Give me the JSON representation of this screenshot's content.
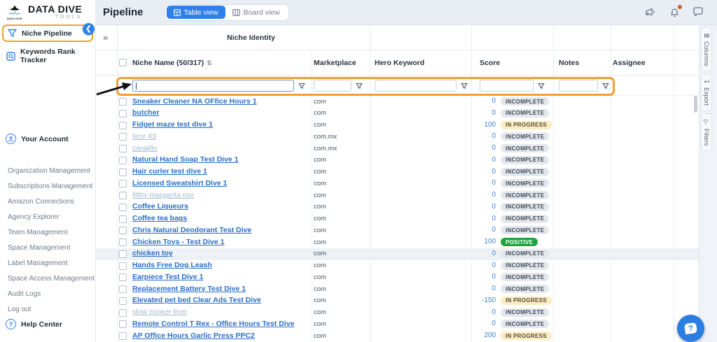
{
  "brand": {
    "name": "DATA DIVE",
    "sub": "TOOLS",
    "logo_caption": "DATA DIVE"
  },
  "topbar": {
    "title": "Pipeline",
    "views": [
      {
        "label": "Table view",
        "active": true
      },
      {
        "label": "Board view",
        "active": false
      }
    ],
    "icons": [
      "megaphone-icon",
      "bell-icon",
      "chat-icon"
    ]
  },
  "sidebar": {
    "nav": [
      {
        "label": "Niche Pipeline",
        "icon": "funnel-icon",
        "highlighted": true
      },
      {
        "label": "Keywords Rank Tracker",
        "icon": "keyword-search-icon"
      }
    ],
    "account_label": "Your Account",
    "management_links": [
      "Organization Management",
      "Subscriptions Management",
      "Amazon Connections",
      "Agency Explorer",
      "Team Management",
      "Space Management",
      "Label Management",
      "Space Access Management",
      "Audit Logs",
      "Log out"
    ],
    "help_label": "Help Center"
  },
  "table": {
    "group_header": "Niche Identity",
    "expand_glyph": "»",
    "columns": {
      "niche_name": "Niche Name (50/317)",
      "marketplace": "Marketplace",
      "hero_keyword": "Hero Keyword",
      "score": "Score",
      "notes": "Notes",
      "assignee": "Assignee"
    },
    "filters": [
      {
        "column": "niche_name",
        "value": "",
        "placeholder": "",
        "focused": true
      },
      {
        "column": "marketplace",
        "value": "",
        "placeholder": "",
        "focused": false
      },
      {
        "column": "hero_keyword",
        "value": "",
        "placeholder": "",
        "focused": false
      },
      {
        "column": "score",
        "value": "",
        "placeholder": "",
        "focused": false
      },
      {
        "column": "notes",
        "value": "",
        "placeholder": "",
        "focused": false
      }
    ],
    "rows": [
      {
        "name": "Sneaker Cleaner NA OFfice Hours 1",
        "marketplace": "com",
        "score": 0,
        "status": "INCOMPLETE",
        "emphasis": "strong",
        "highlighted": false
      },
      {
        "name": "butcher",
        "marketplace": "com",
        "score": 0,
        "status": "INCOMPLETE",
        "emphasis": "strong",
        "highlighted": false
      },
      {
        "name": "Fidget maze test dive 1",
        "marketplace": "com",
        "score": 100,
        "status": "IN PROGRESS",
        "emphasis": "strong",
        "highlighted": false
      },
      {
        "name": "licor 43",
        "marketplace": "com.mx",
        "score": 0,
        "status": "INCOMPLETE",
        "emphasis": "muted",
        "highlighted": false
      },
      {
        "name": "carajillo",
        "marketplace": "com.mx",
        "score": 0,
        "status": "INCOMPLETE",
        "emphasis": "muted",
        "highlighted": false
      },
      {
        "name": "Natural Hand Soap Test Dive 1",
        "marketplace": "com",
        "score": 0,
        "status": "INCOMPLETE",
        "emphasis": "strong",
        "highlighted": false
      },
      {
        "name": "Hair curler test dive 1",
        "marketplace": "com",
        "score": 0,
        "status": "INCOMPLETE",
        "emphasis": "strong",
        "highlighted": false
      },
      {
        "name": "Licensed Sweatshirt Dive 1",
        "marketplace": "com",
        "score": 0,
        "status": "INCOMPLETE",
        "emphasis": "strong",
        "highlighted": false
      },
      {
        "name": "filthy margarita mix",
        "marketplace": "com",
        "score": 0,
        "status": "INCOMPLETE",
        "emphasis": "muted",
        "highlighted": false
      },
      {
        "name": "Coffee Liqueurs",
        "marketplace": "com",
        "score": 0,
        "status": "INCOMPLETE",
        "emphasis": "strong",
        "highlighted": false
      },
      {
        "name": "Coffee tea bags",
        "marketplace": "com",
        "score": 0,
        "status": "INCOMPLETE",
        "emphasis": "strong",
        "highlighted": false
      },
      {
        "name": "Chris Natural Deodorant Test Dive",
        "marketplace": "com",
        "score": 0,
        "status": "INCOMPLETE",
        "emphasis": "strong",
        "highlighted": false
      },
      {
        "name": "Chicken Toys - Test Dive 1",
        "marketplace": "com",
        "score": 100,
        "status": "POSITIVE",
        "emphasis": "strong",
        "highlighted": false
      },
      {
        "name": "chicken toy",
        "marketplace": "com",
        "score": 0,
        "status": "INCOMPLETE",
        "emphasis": "strong",
        "highlighted": true
      },
      {
        "name": "Hands Free Dog Leash",
        "marketplace": "com",
        "score": 0,
        "status": "INCOMPLETE",
        "emphasis": "strong",
        "highlighted": false
      },
      {
        "name": "Earpiece Test Dive 1",
        "marketplace": "com",
        "score": 0,
        "status": "INCOMPLETE",
        "emphasis": "strong",
        "highlighted": false
      },
      {
        "name": "Replacement Battery Test Dive 1",
        "marketplace": "com",
        "score": 0,
        "status": "INCOMPLETE",
        "emphasis": "strong",
        "highlighted": false
      },
      {
        "name": "Elevated pet bed Clear Ads Test Dive",
        "marketplace": "com",
        "score": -150,
        "status": "IN PROGRESS",
        "emphasis": "strong",
        "highlighted": false
      },
      {
        "name": "slow cooker liner",
        "marketplace": "com",
        "score": 0,
        "status": "INCOMPLETE",
        "emphasis": "muted",
        "highlighted": false
      },
      {
        "name": "Remote Control T Rex - Office Hours Test Dive",
        "marketplace": "com",
        "score": 0,
        "status": "INCOMPLETE",
        "emphasis": "strong",
        "highlighted": false
      },
      {
        "name": "AP Office Hours Garlic Press PPC2",
        "marketplace": "com",
        "score": 200,
        "status": "IN PROGRESS",
        "emphasis": "strong",
        "highlighted": false
      }
    ]
  },
  "side_tabs": [
    {
      "label": "Columns",
      "icon": "columns-icon",
      "glyph": "≣"
    },
    {
      "label": "Export",
      "icon": "export-icon",
      "glyph": "↧"
    },
    {
      "label": "Filters",
      "icon": "filters-icon",
      "glyph": "▽"
    }
  ],
  "colors": {
    "accent_blue": "#2f80ed",
    "highlight_orange": "#f0a032",
    "badge_incomplete_bg": "#e4e8ed",
    "badge_incomplete_text": "#414b58",
    "badge_inprogress_bg": "#fcecc0",
    "badge_inprogress_text": "#57503f",
    "badge_positive_bg": "#1ea23c",
    "badge_positive_text": "#ffffff",
    "link_strong": "#2a6fc8",
    "link_muted": "#a3b8cd",
    "notification_dot": "#d9572b"
  }
}
